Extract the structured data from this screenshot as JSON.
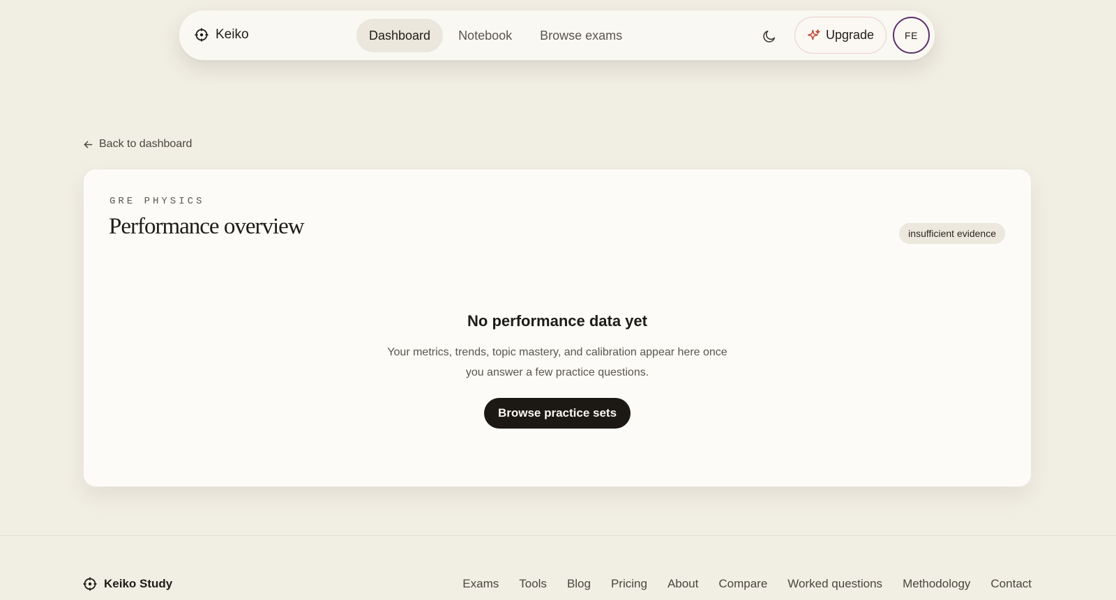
{
  "nav": {
    "brand": "Keiko",
    "tabs": [
      {
        "label": "Dashboard",
        "active": true
      },
      {
        "label": "Notebook",
        "active": false
      },
      {
        "label": "Browse exams",
        "active": false
      }
    ],
    "upgrade_label": "Upgrade",
    "avatar_initials": "FE"
  },
  "back_link": "Back to dashboard",
  "card": {
    "eyebrow": "GRE PHYSICS",
    "title": "Performance overview",
    "badge": "insufficient evidence",
    "empty_title": "No performance data yet",
    "empty_text_line1": "Your metrics, trends, topic mastery, and calibration appear here once",
    "empty_text_line2": "you answer a few practice questions.",
    "cta_label": "Browse practice sets"
  },
  "footer": {
    "brand": "Keiko Study",
    "links": [
      "Exams",
      "Tools",
      "Blog",
      "Pricing",
      "About",
      "Compare",
      "Worked questions",
      "Methodology",
      "Contact"
    ]
  },
  "colors": {
    "background": "#f1eee4",
    "card": "#fcfbf8",
    "cta": "#1c1814",
    "avatar_ring": "#5b2e6b",
    "upgrade_accent": "#b8432f"
  },
  "icons": {
    "brand": "crosshair-icon",
    "theme": "moon-icon",
    "upgrade": "sparkle-icon",
    "back": "arrow-left-icon"
  }
}
